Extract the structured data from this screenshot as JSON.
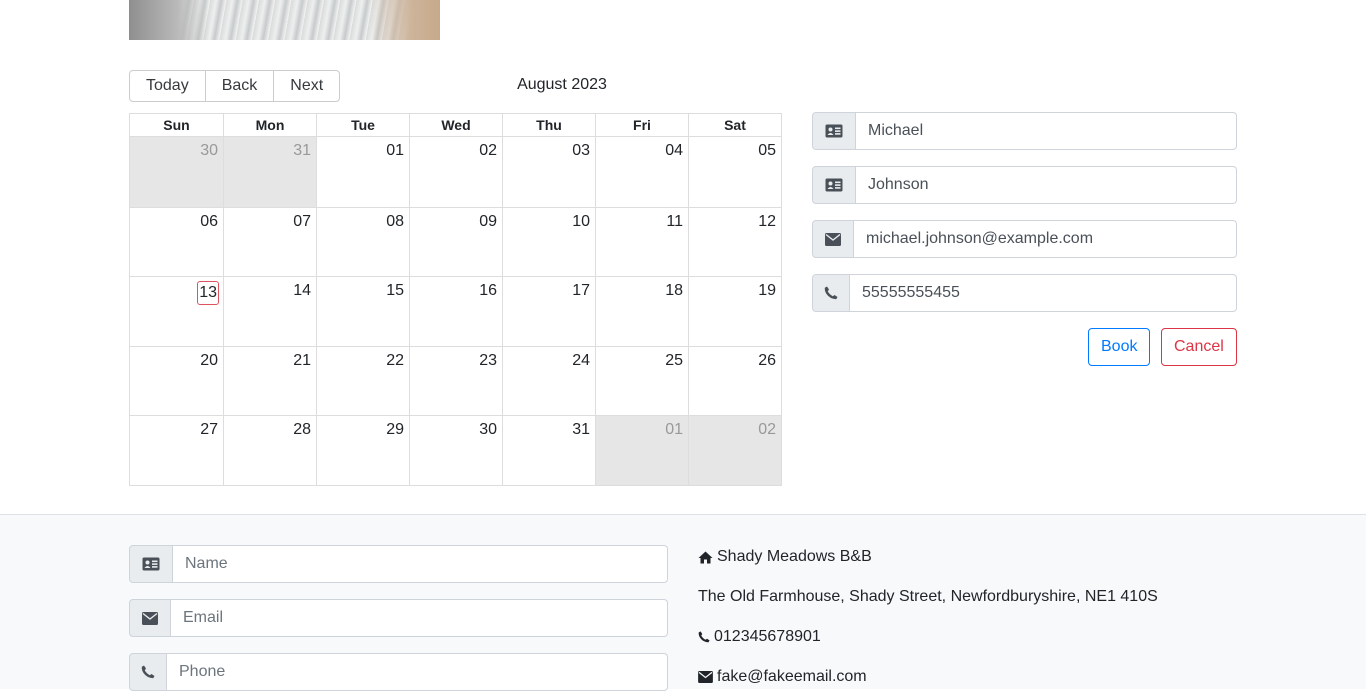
{
  "calendar": {
    "toolbar": {
      "today": "Today",
      "back": "Back",
      "next": "Next"
    },
    "month_label": "August 2023",
    "weekdays": [
      "Sun",
      "Mon",
      "Tue",
      "Wed",
      "Thu",
      "Fri",
      "Sat"
    ],
    "weeks": [
      [
        "30",
        "31",
        "01",
        "02",
        "03",
        "04",
        "05"
      ],
      [
        "06",
        "07",
        "08",
        "09",
        "10",
        "11",
        "12"
      ],
      [
        "13",
        "14",
        "15",
        "16",
        "17",
        "18",
        "19"
      ],
      [
        "20",
        "21",
        "22",
        "23",
        "24",
        "25",
        "26"
      ],
      [
        "27",
        "28",
        "29",
        "30",
        "31",
        "01",
        "02"
      ]
    ]
  },
  "booking": {
    "firstname": "Michael",
    "lastname": "Johnson",
    "email": "michael.johnson@example.com",
    "phone": "55555555455",
    "book_label": "Book",
    "cancel_label": "Cancel"
  },
  "contact_form": {
    "name_placeholder": "Name",
    "email_placeholder": "Email",
    "phone_placeholder": "Phone"
  },
  "contact_info": {
    "name": "Shady Meadows B&B",
    "address": "The Old Farmhouse, Shady Street, Newfordburyshire, NE1 410S",
    "phone": "012345678901",
    "email": "fake@fakeemail.com"
  },
  "colors": {
    "primary": "#007bff",
    "danger": "#dc3545",
    "today_outline": "#e05260",
    "off_range_bg": "#e6e6e6"
  }
}
